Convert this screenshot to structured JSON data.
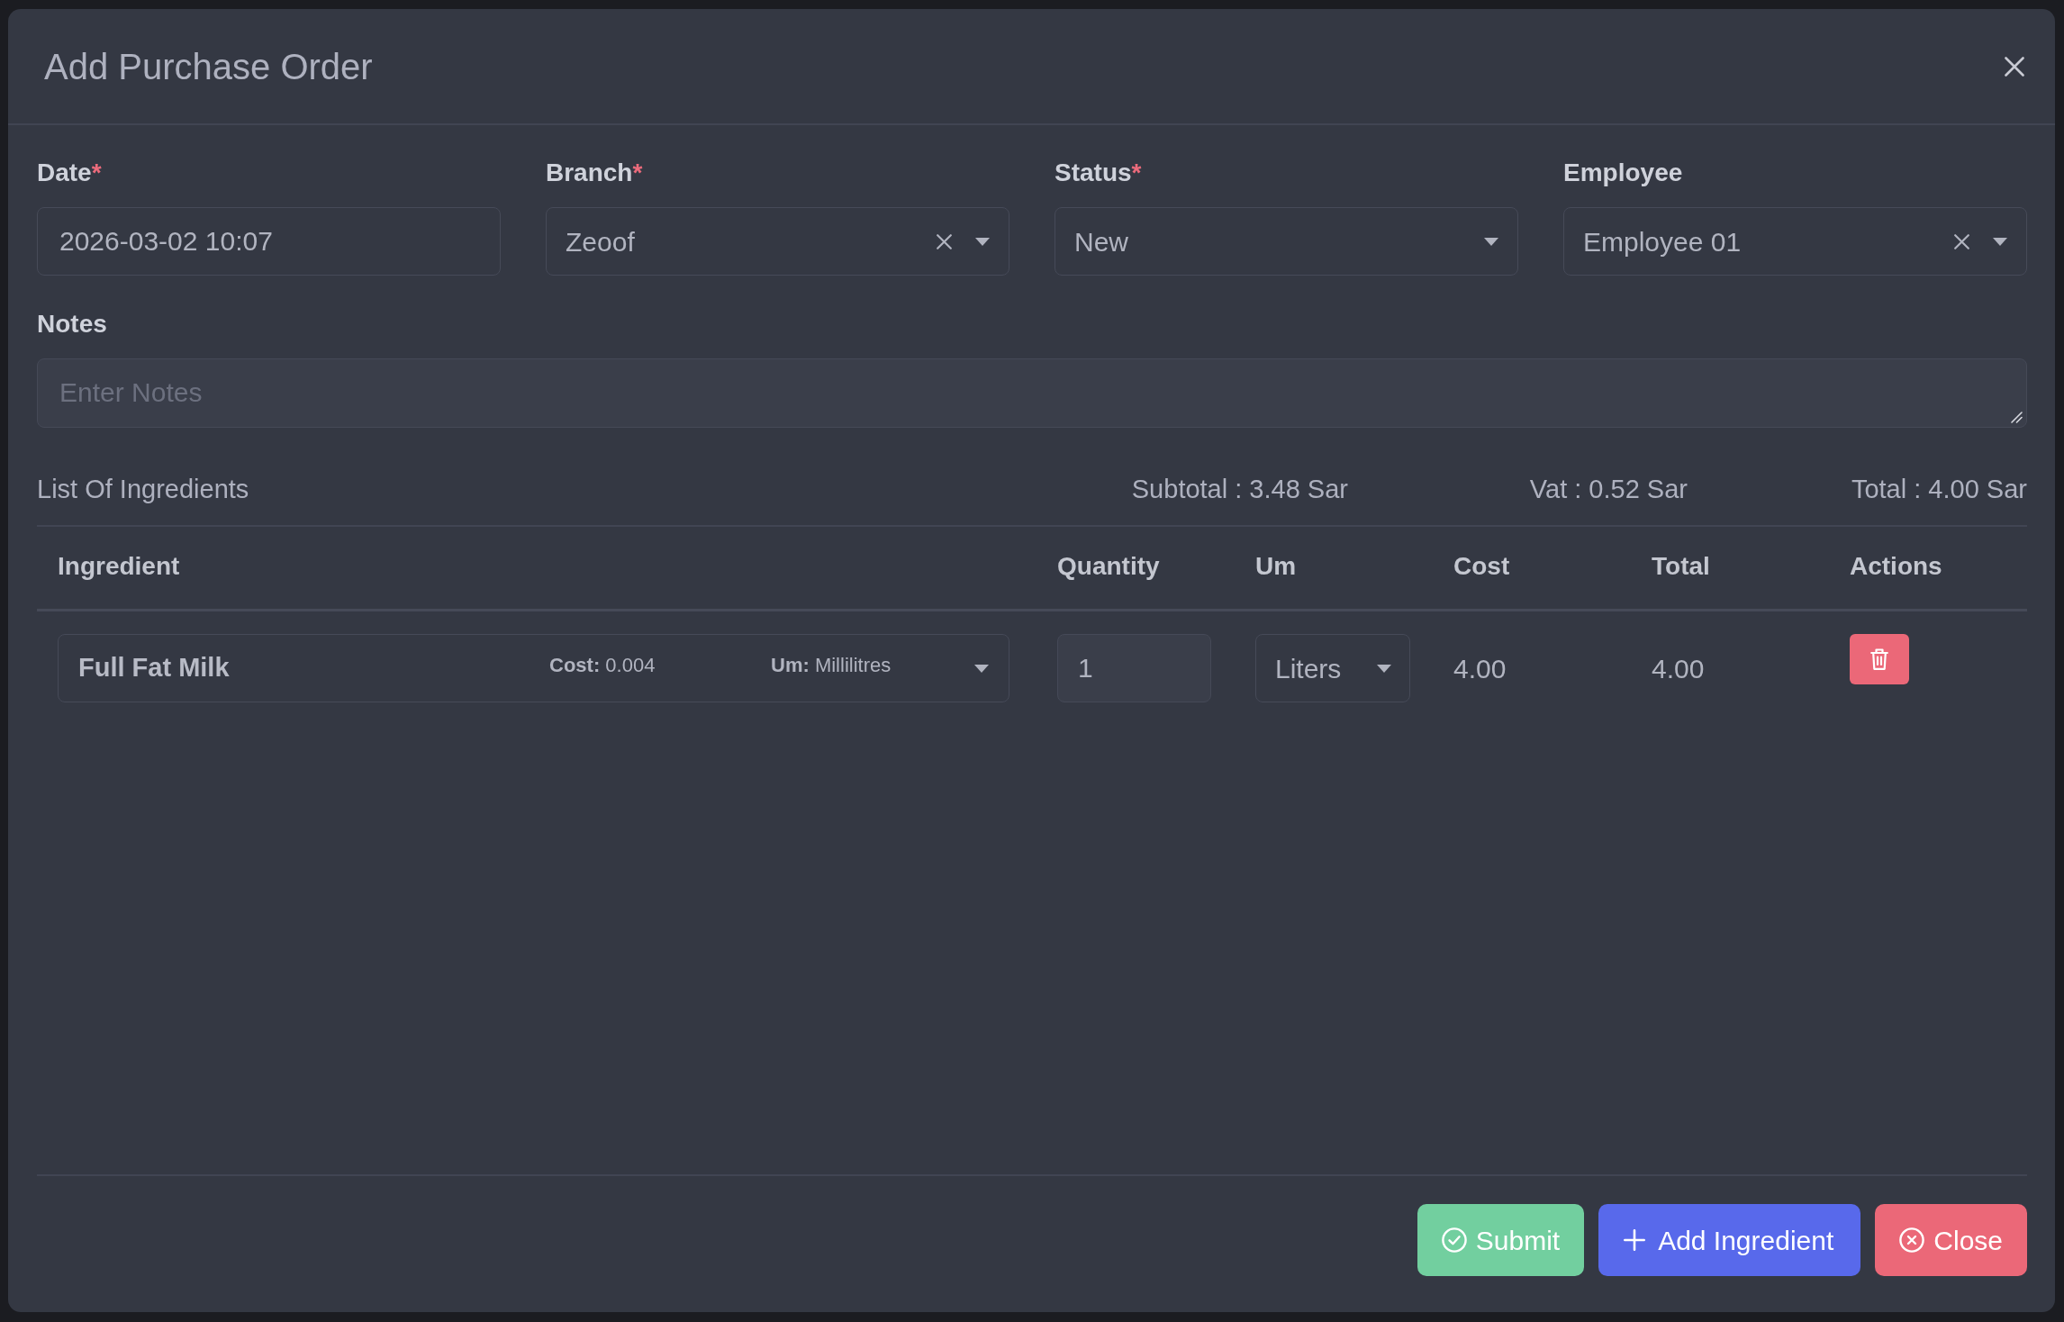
{
  "dialog": {
    "title": "Add Purchase Order"
  },
  "fields": [
    {
      "kind": "text",
      "label": "Date",
      "required_mark": "*",
      "value": "2026-03-02 10:07",
      "clearable": false
    },
    {
      "kind": "select",
      "label": "Branch",
      "required_mark": "*",
      "value": "Zeoof",
      "clearable": true
    },
    {
      "kind": "select",
      "label": "Status",
      "required_mark": "*",
      "value": "New",
      "clearable": false
    },
    {
      "kind": "select",
      "label": "Employee",
      "value": "Employee 01",
      "clearable": true
    }
  ],
  "notes": {
    "label": "Notes",
    "placeholder": "Enter Notes"
  },
  "ingredients": {
    "title": "List Of Ingredients",
    "summary": [
      "Subtotal : 3.48 Sar",
      "Vat : 0.52 Sar",
      "Total : 4.00 Sar"
    ],
    "table": {
      "columns": [
        "Ingredient",
        "Quantity",
        "Um",
        "Cost",
        "Total",
        "Actions"
      ],
      "rows": [
        {
          "ingredient": {
            "name": "Full Fat Milk",
            "cost": "**Cost:** 0.004",
            "unit": "**Um:** Millilitres"
          },
          "quantity": "1",
          "um": "Liters",
          "cost": "4.00",
          "total": "4.00"
        }
      ]
    }
  },
  "footer_buttons": [
    {
      "kind": "submit",
      "label": "Submit"
    },
    {
      "kind": "add",
      "label": "Add Ingredient"
    },
    {
      "kind": "close",
      "label": "Close"
    }
  ]
}
